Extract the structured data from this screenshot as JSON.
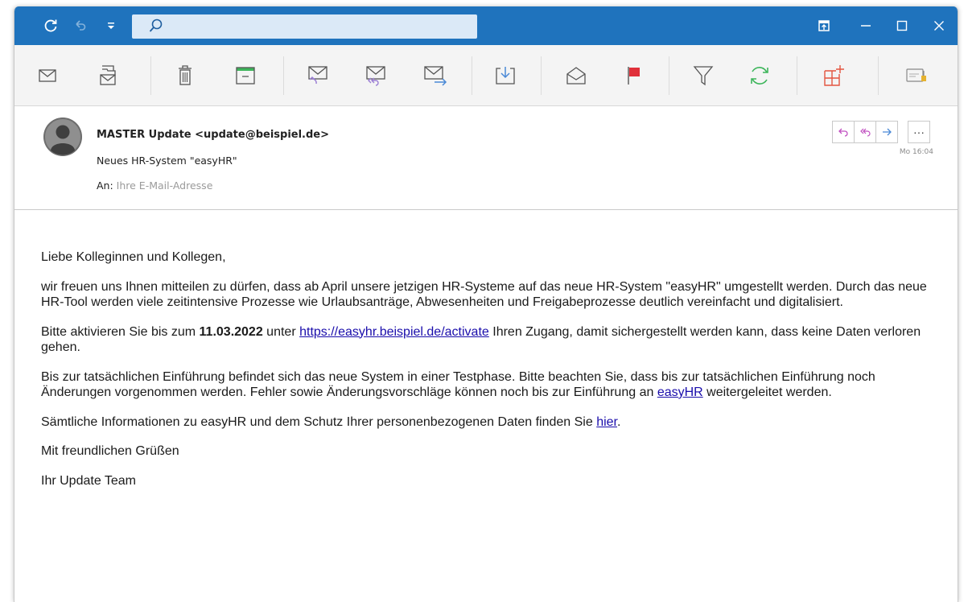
{
  "titlebar": {
    "search_placeholder": "",
    "icons": [
      "refresh-icon",
      "undo-icon",
      "dropdown-icon",
      "search-icon",
      "restore-icon",
      "minimize-icon",
      "maximize-icon",
      "close-icon"
    ],
    "accent": "#1f73bd"
  },
  "toolbar": {
    "tools": [
      "new-mail",
      "move-to-folder",
      "delete",
      "archive",
      "reply",
      "reply-all",
      "forward",
      "download",
      "mark-read",
      "flag",
      "filter",
      "sync",
      "add-view",
      "settings"
    ],
    "flag_color": "#e0303a",
    "sync_color": "#3cb55a",
    "addview_color": "#e3553f"
  },
  "email": {
    "sender": "MASTER Update <update@beispiel.de>",
    "subject": "Neues HR-System \"easyHR\"",
    "to_label": "An:",
    "to_address": "Ihre E-Mail-Adresse",
    "time": "Mo 16:04",
    "more_label": "···"
  },
  "body": {
    "greeting": "Liebe Kolleginnen und Kollegen,",
    "p1": "wir freuen uns Ihnen mitteilen zu dürfen, dass ab April unsere jetzigen HR-Systeme auf das neue HR-System \"easyHR\" umgestellt werden. Durch das neue HR-Tool werden viele zeitintensive Prozesse wie Urlaubsanträge, Abwesenheiten und Freigabeprozesse deutlich vereinfacht und digitalisiert.",
    "p2_pre": "Bitte aktivieren Sie bis zum ",
    "p2_date": "11.03.2022",
    "p2_mid": " unter ",
    "p2_link": "https://easyhr.beispiel.de/activate",
    "p2_post": " Ihren Zugang, damit sichergestellt werden kann, dass keine Daten verloren gehen.",
    "p3_pre": "Bis zur tatsächlichen Einführung befindet sich das neue System in einer Testphase. Bitte beachten Sie, dass bis zur tatsächlichen Einführung noch Änderungen vorgenommen werden. Fehler sowie Änderungsvorschläge können noch bis zur Einführung an ",
    "p3_link": "easyHR",
    "p3_post": " weitergeleitet werden.",
    "p4_pre": "Sämtliche Informationen zu easyHR und dem Schutz Ihrer personenbezogenen Daten finden Sie ",
    "p4_link": "hier",
    "p4_post": ".",
    "closing": "Mit freundlichen Grüßen",
    "signature": "Ihr Update Team"
  }
}
